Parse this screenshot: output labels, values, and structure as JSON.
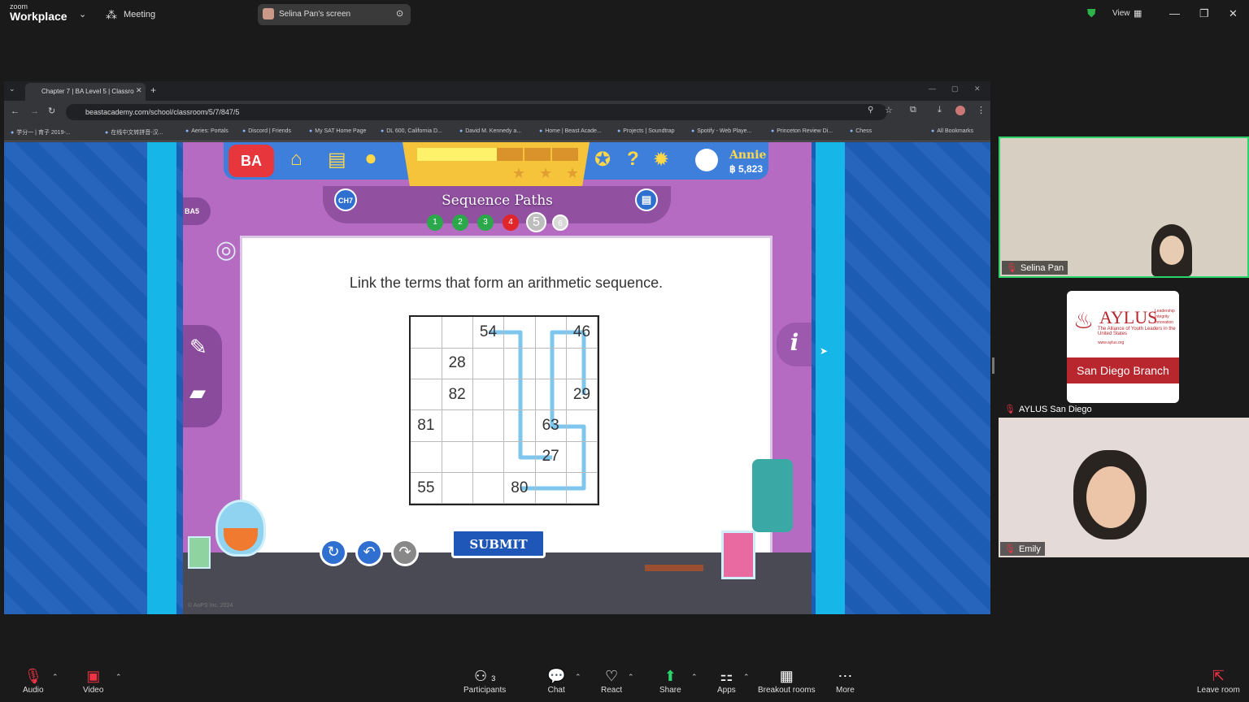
{
  "zoom": {
    "brand_small": "zoom",
    "brand": "Workplace",
    "meeting_label": "Meeting",
    "screen_share_label": "Selina Pan's screen",
    "view_label": "View"
  },
  "browser": {
    "tab_title": "Chapter 7 | BA Level 5 | Classro",
    "url": "beastacademy.com/school/classroom/5/7/847/5",
    "bookmarks": [
      "学分一 | 育子 2019-...",
      "在线中文转拼音-汉...",
      "Aeries: Portals",
      "Discord | Friends",
      "My SAT Home Page",
      "DL 600, California D...",
      "David M. Kennedy a...",
      "Home | Beast Acade...",
      "Projects | Soundtrap",
      "Spotify - Web Playe...",
      "Princeton Review Di...",
      "Chess",
      "All Bookmarks"
    ]
  },
  "game": {
    "logo": "BA",
    "user_name": "Annie",
    "user_bucks": "฿ 5,823",
    "chapter_badge": "CH7",
    "side_badge": "BA5",
    "title": "Sequence Paths",
    "levels": [
      {
        "label": "1",
        "status": "done"
      },
      {
        "label": "2",
        "status": "done"
      },
      {
        "label": "3",
        "status": "done"
      },
      {
        "label": "4",
        "status": "failed"
      },
      {
        "label": "5",
        "status": "current"
      },
      {
        "label": "6",
        "status": "locked"
      }
    ],
    "prompt": "Link the terms that form an arithmetic sequence.",
    "grid_rows": [
      [
        "",
        "",
        "54",
        "",
        "",
        "46"
      ],
      [
        "",
        "28",
        "",
        "",
        "",
        ""
      ],
      [
        "",
        "82",
        "",
        "",
        "",
        "29"
      ],
      [
        "81",
        "",
        "",
        "",
        "63",
        ""
      ],
      [
        "",
        "",
        "",
        "",
        "27",
        ""
      ],
      [
        "55",
        "",
        "",
        "80",
        "",
        ""
      ]
    ],
    "submit_label": "SUBMIT",
    "info_label": "i",
    "copyright": "© AoPS Inc. 2024",
    "colors": {
      "path": "#7ec6ee",
      "done": "#2aa84a",
      "failed": "#e0262a",
      "current": "#bdbdbd",
      "locked": "#d9d9d9"
    }
  },
  "participants_videos": [
    {
      "name": "Selina Pan"
    },
    {
      "name": "AYLUS San Diego"
    },
    {
      "name": "Emily"
    }
  ],
  "aylus_card": {
    "title": "AYLUS",
    "tag1": "Leadership",
    "tag2": "Integrity",
    "tag3": "Innovation",
    "subtitle": "The Alliance of Youth Leaders in the United States",
    "site": "www.aylus.org",
    "branch": "San Diego Branch"
  },
  "toolbar": {
    "audio": "Audio",
    "video": "Video",
    "participants": "Participants",
    "participants_count": "3",
    "chat": "Chat",
    "react": "React",
    "share": "Share",
    "apps": "Apps",
    "breakout": "Breakout rooms",
    "more": "More",
    "leave": "Leave room"
  }
}
